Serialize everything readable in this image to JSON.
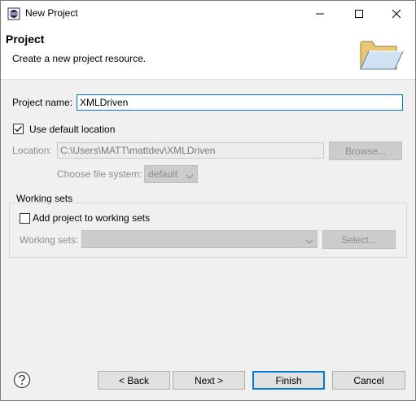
{
  "window": {
    "title": "New Project",
    "minimize_icon": "minimize-icon",
    "maximize_icon": "maximize-icon",
    "close_icon": "close-icon"
  },
  "banner": {
    "title": "Project",
    "description": "Create a new project resource.",
    "icon": "open-folder-icon"
  },
  "form": {
    "project_name_label": "Project name:",
    "project_name_value": "XMLDriven",
    "use_default_location_label": "Use default location",
    "use_default_location_checked": true,
    "location_label": "Location:",
    "location_value": "C:\\Users\\MATT\\mattdev\\XMLDriven",
    "browse_label": "Browse...",
    "file_system_label": "Choose file system:",
    "file_system_value": "default"
  },
  "working_sets": {
    "group_label": "Working sets",
    "add_label": "Add project to working sets",
    "add_checked": false,
    "sets_label": "Working sets:",
    "sets_value": "",
    "select_label": "Select..."
  },
  "footer": {
    "help_icon": "help-icon",
    "back_label": "< Back",
    "next_label": "Next >",
    "finish_label": "Finish",
    "cancel_label": "Cancel"
  },
  "colors": {
    "focus_border": "#0078d7",
    "disabled_text": "#8d8d8d",
    "dialog_bg": "#f0f0f0"
  }
}
